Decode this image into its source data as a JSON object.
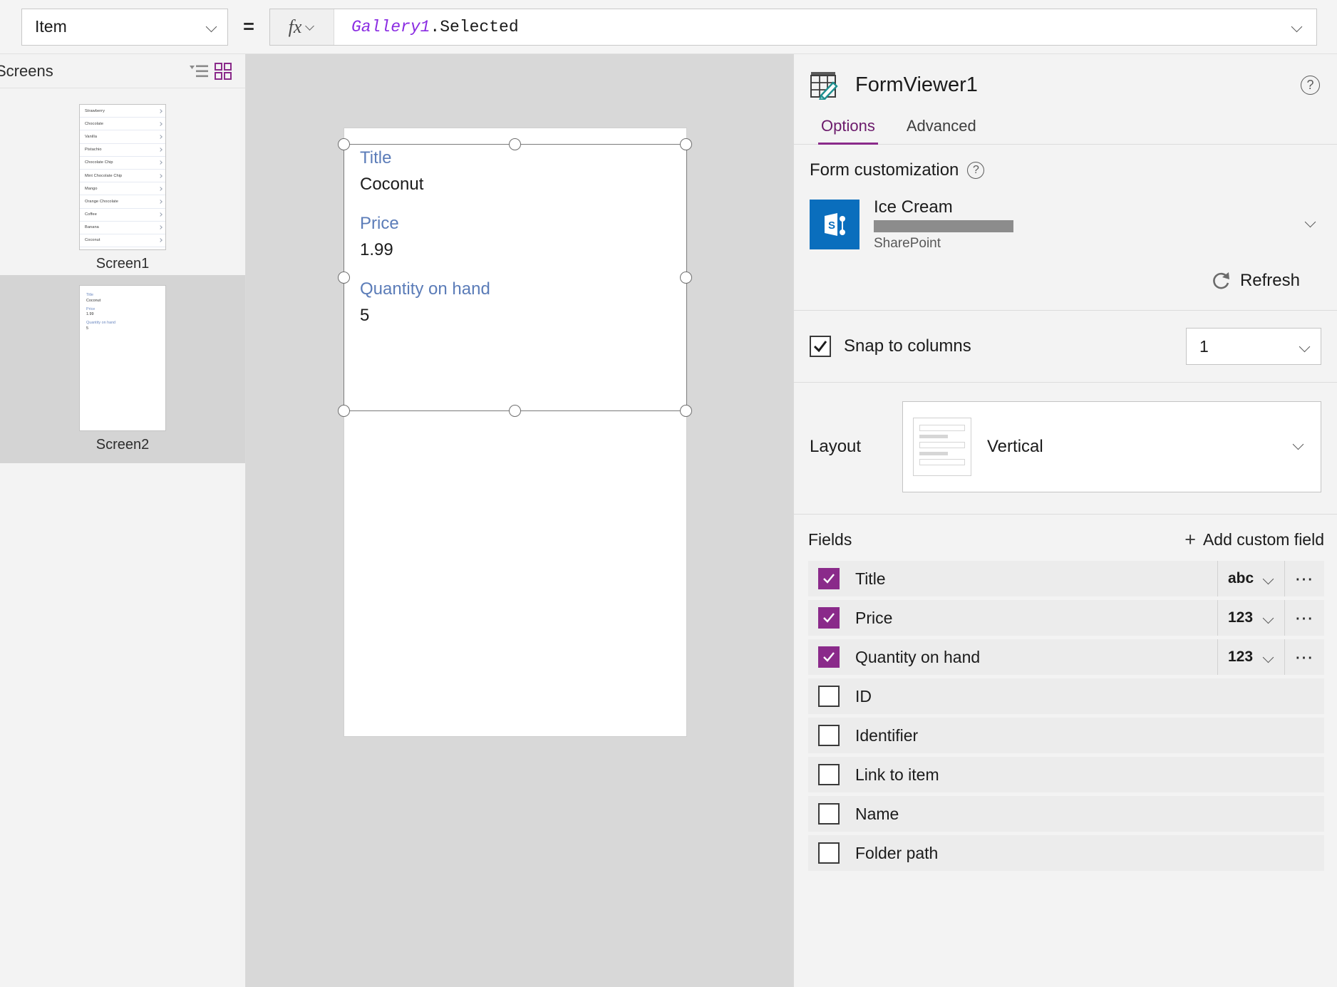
{
  "formula_bar": {
    "property": "Item",
    "equals": "=",
    "fx_label": "fx",
    "formula_identifier": "Gallery1",
    "formula_rest": ".Selected"
  },
  "left_panel": {
    "title": "Screens",
    "screens": [
      {
        "label": "Screen1",
        "selected": false,
        "gallery_items": [
          "Strawberry",
          "Chocolate",
          "Vanilla",
          "Pistachio",
          "Chocolate Chip",
          "Mint Chocolate Chip",
          "Mango",
          "Orange Chocolate",
          "Coffee",
          "Banana",
          "Coconut"
        ]
      },
      {
        "label": "Screen2",
        "selected": true,
        "form_preview": [
          {
            "label": "Title",
            "value": "Coconut"
          },
          {
            "label": "Price",
            "value": "1.99"
          },
          {
            "label": "Quantity on hand",
            "value": "5"
          }
        ]
      }
    ]
  },
  "canvas": {
    "form_fields": [
      {
        "label": "Title",
        "value": "Coconut"
      },
      {
        "label": "Price",
        "value": "1.99"
      },
      {
        "label": "Quantity on hand",
        "value": "5"
      }
    ]
  },
  "right_panel": {
    "title": "FormViewer1",
    "help": "?",
    "tabs": [
      {
        "label": "Options",
        "active": true
      },
      {
        "label": "Advanced",
        "active": false
      }
    ],
    "form_customization": {
      "heading": "Form customization",
      "help": "?",
      "data_source": {
        "name": "Ice Cream",
        "account_redacted": "",
        "type": "SharePoint"
      },
      "refresh_label": "Refresh"
    },
    "snap_to_columns": {
      "label": "Snap to columns",
      "checked": true,
      "columns_value": "1"
    },
    "layout": {
      "label": "Layout",
      "value": "Vertical"
    },
    "fields": {
      "heading": "Fields",
      "add_label": "Add custom field",
      "add_icon": "plus-icon",
      "rows": [
        {
          "name": "Title",
          "checked": true,
          "type": "abc",
          "has_menu": true
        },
        {
          "name": "Price",
          "checked": true,
          "type": "123",
          "has_menu": true
        },
        {
          "name": "Quantity on hand",
          "checked": true,
          "type": "123",
          "has_menu": true
        },
        {
          "name": "ID",
          "checked": false,
          "type": "",
          "has_menu": false
        },
        {
          "name": "Identifier",
          "checked": false,
          "type": "",
          "has_menu": false
        },
        {
          "name": "Link to item",
          "checked": false,
          "type": "",
          "has_menu": false
        },
        {
          "name": "Name",
          "checked": false,
          "type": "",
          "has_menu": false
        },
        {
          "name": "Folder path",
          "checked": false,
          "type": "",
          "has_menu": false
        }
      ]
    }
  },
  "colors": {
    "accent_purple": "#8a2a8a",
    "field_label_blue": "#5b7cb8",
    "sharepoint_blue": "#0a6ebd",
    "form_icon_teal": "#1d8f8f"
  }
}
